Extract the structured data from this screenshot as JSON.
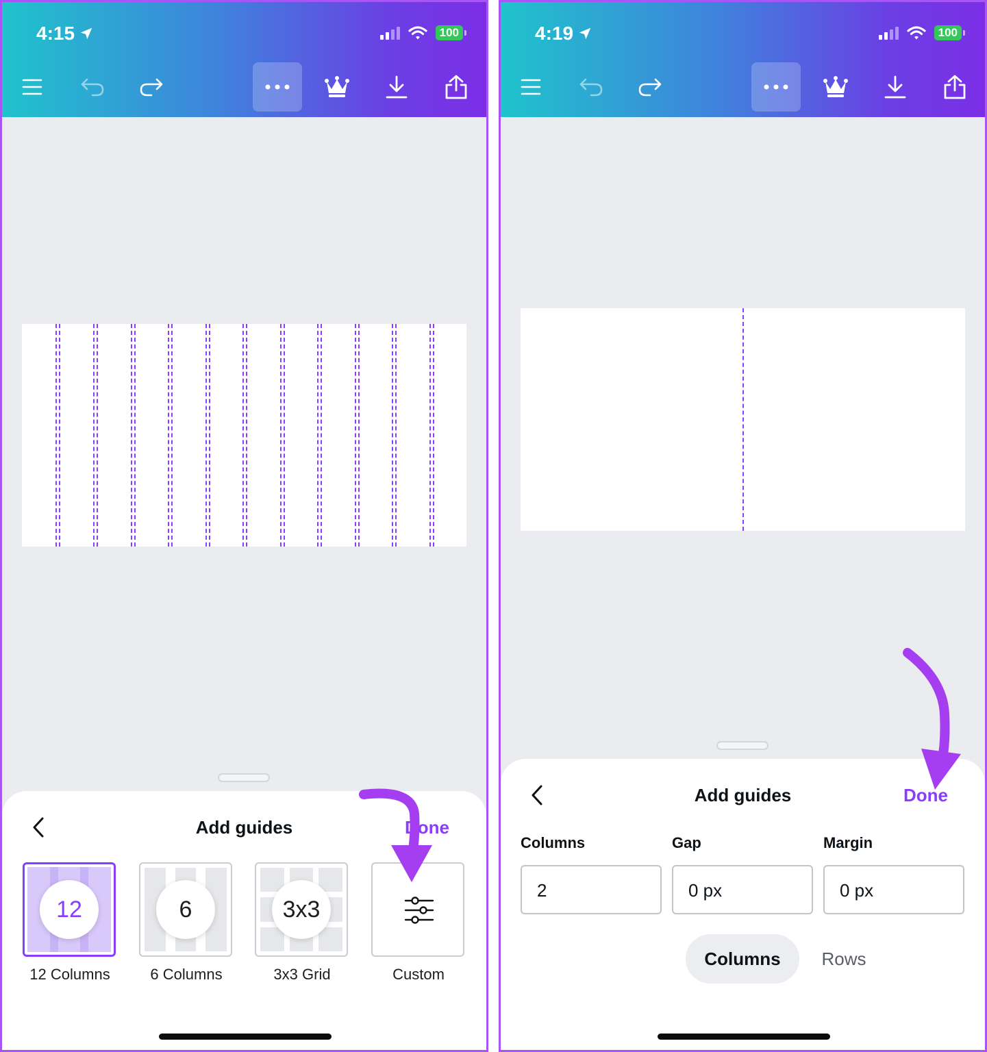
{
  "left": {
    "status": {
      "time": "4:15",
      "battery": "100"
    },
    "sheet": {
      "title": "Add guides",
      "done_label": "Done",
      "presets": [
        {
          "label": "12 Columns",
          "badge": "12",
          "selected": true
        },
        {
          "label": "6 Columns",
          "badge": "6",
          "selected": false
        },
        {
          "label": "3x3 Grid",
          "badge": "3x3",
          "selected": false
        },
        {
          "label": "Custom",
          "badge": "",
          "selected": false
        }
      ]
    }
  },
  "right": {
    "status": {
      "time": "4:19",
      "battery": "100"
    },
    "sheet": {
      "title": "Add guides",
      "done_label": "Done",
      "fields": [
        {
          "label": "Columns",
          "value": "2"
        },
        {
          "label": "Gap",
          "value": "0 px"
        },
        {
          "label": "Margin",
          "value": "0 px"
        }
      ],
      "segments": [
        "Columns",
        "Rows"
      ],
      "active_segment": "Columns"
    }
  },
  "colors": {
    "accent": "#8b3dff",
    "annotation_arrow": "#a43ef0",
    "frame": "#a855f7"
  },
  "icons": [
    "menu-icon",
    "undo-icon",
    "redo-icon",
    "more-icon",
    "crown-icon",
    "download-icon",
    "share-icon",
    "location-arrow-icon",
    "wifi-icon",
    "chevron-left-icon",
    "sliders-icon"
  ]
}
